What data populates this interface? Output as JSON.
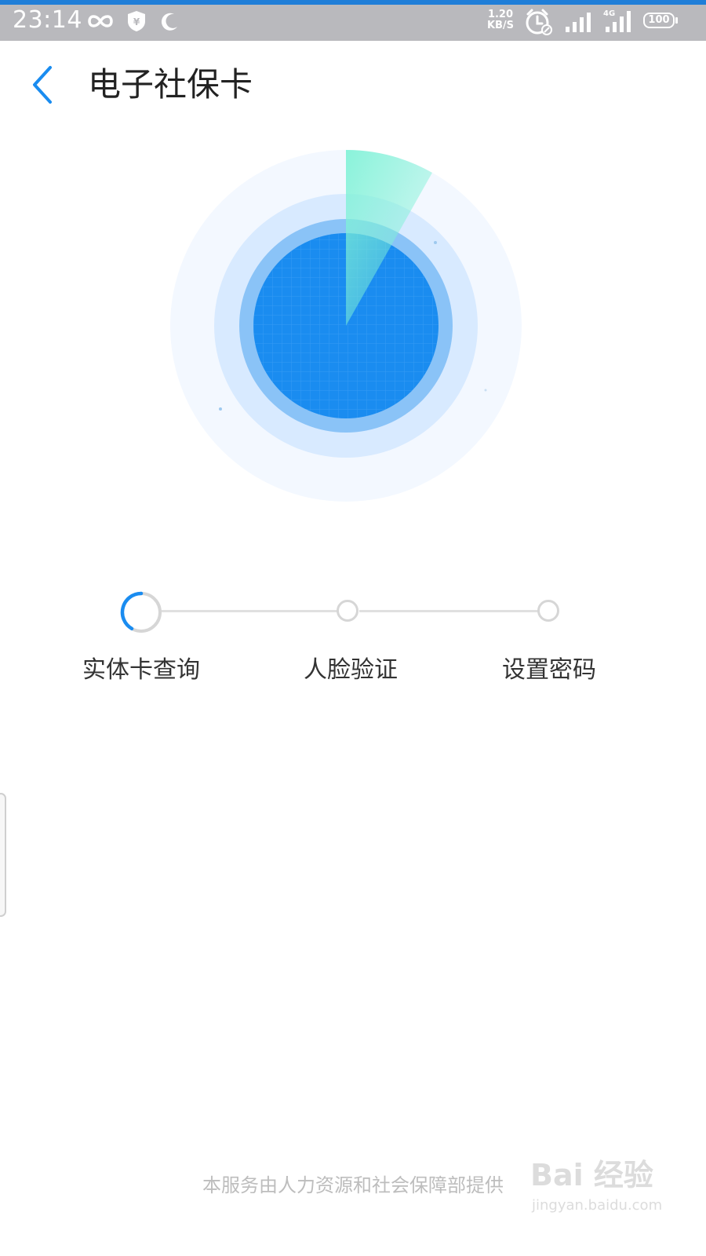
{
  "status_bar": {
    "time": "23:14",
    "net_speed_value": "1.20",
    "net_speed_unit": "KB/S",
    "battery": "100",
    "icons": [
      "infinity-icon",
      "shield-yen-icon",
      "moon-icon",
      "alarm-icon",
      "signal-icon",
      "signal-4g-icon",
      "battery-icon"
    ]
  },
  "header": {
    "title": "电子社保卡",
    "back_icon": "chevron-left-icon"
  },
  "steps": [
    {
      "label": "实体卡查询",
      "state": "in-progress"
    },
    {
      "label": "人脸验证",
      "state": "pending"
    },
    {
      "label": "设置密码",
      "state": "pending"
    }
  ],
  "footer": {
    "text": "本服务由人力资源和社会保障部提供"
  },
  "watermark": {
    "logo_text": "Bai 经验",
    "sub_text": "jingyan.baidu.com"
  },
  "colors": {
    "accent": "#1a8cf0",
    "radar_sweep": "#7ef2d6",
    "text_dark": "#222222",
    "text_muted": "#bdbdbd"
  }
}
